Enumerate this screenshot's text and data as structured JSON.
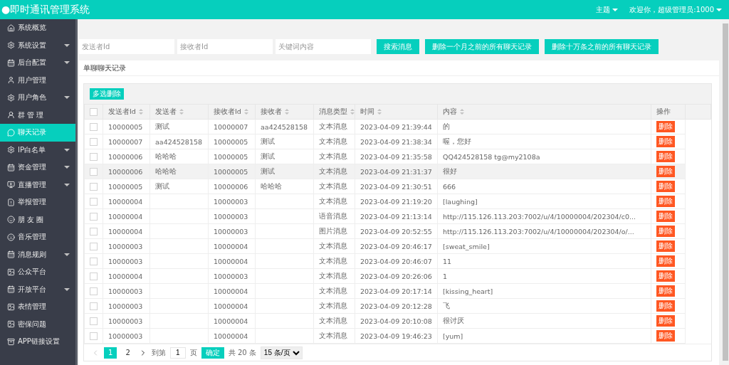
{
  "header": {
    "title": "●即时通讯管理系统",
    "theme_menu": "主题",
    "user_menu": "欢迎你，超级管理员:1000"
  },
  "sidebar": {
    "items": [
      {
        "label": "系统概览",
        "selected": false,
        "expandable": false
      },
      {
        "label": "系统设置",
        "selected": false,
        "expandable": true
      },
      {
        "label": "后台配置",
        "selected": false,
        "expandable": true
      },
      {
        "label": "用户管理",
        "selected": false,
        "expandable": false
      },
      {
        "label": "用户角色",
        "selected": false,
        "expandable": true
      },
      {
        "label": "群 管 理",
        "selected": false,
        "expandable": false
      },
      {
        "label": "聊天记录",
        "selected": true,
        "expandable": false
      },
      {
        "label": "IP白名单",
        "selected": false,
        "expandable": true
      },
      {
        "label": "资金管理",
        "selected": false,
        "expandable": true
      },
      {
        "label": "直播管理",
        "selected": false,
        "expandable": true
      },
      {
        "label": "举报管理",
        "selected": false,
        "expandable": false
      },
      {
        "label": "朋 友 圈",
        "selected": false,
        "expandable": false
      },
      {
        "label": "音乐管理",
        "selected": false,
        "expandable": false
      },
      {
        "label": "消息规则",
        "selected": false,
        "expandable": true
      },
      {
        "label": "公众平台",
        "selected": false,
        "expandable": false
      },
      {
        "label": "开放平台",
        "selected": false,
        "expandable": true
      },
      {
        "label": "表情管理",
        "selected": false,
        "expandable": false
      },
      {
        "label": "密保问题",
        "selected": false,
        "expandable": false
      },
      {
        "label": "APP链接设置",
        "selected": false,
        "expandable": false
      }
    ]
  },
  "filters": {
    "fields": [
      {
        "placeholder": "发送者Id"
      },
      {
        "placeholder": "接收者Id"
      },
      {
        "placeholder": "关键词内容"
      }
    ],
    "buttons": [
      "搜索消息",
      "删除一个月之前的所有聊天记录",
      "删除十万条之前的所有聊天记录"
    ]
  },
  "panel": {
    "title": "单聊聊天记录",
    "batch_delete": "多选删除",
    "table": {
      "select_all_checked": false,
      "columns": [
        "发送者Id",
        "发送者",
        "接收者Id",
        "接收者",
        "消息类型",
        "时间",
        "内容",
        "操作"
      ],
      "sortable": [
        true,
        true,
        true,
        true,
        true,
        true,
        true,
        false
      ],
      "rows": [
        {
          "cells": [
            "10000005",
            "测试",
            "10000007",
            "aa424528158",
            "文本消息",
            "2023-04-09 21:39:44",
            "的"
          ],
          "action": "删除",
          "checked": false,
          "hovered": false
        },
        {
          "cells": [
            "10000007",
            "aa424528158",
            "10000005",
            "测试",
            "文本消息",
            "2023-04-09 21:38:34",
            "喔，您好"
          ],
          "action": "删除",
          "checked": false,
          "hovered": false
        },
        {
          "cells": [
            "10000006",
            "哈哈哈",
            "10000005",
            "测试",
            "文本消息",
            "2023-04-09 21:35:58",
            "QQ424528158 tg@my2108a"
          ],
          "action": "删除",
          "checked": false,
          "hovered": false
        },
        {
          "cells": [
            "10000006",
            "哈哈哈",
            "10000005",
            "测试",
            "文本消息",
            "2023-04-09 21:31:37",
            "很好"
          ],
          "action": "删除",
          "checked": false,
          "hovered": true
        },
        {
          "cells": [
            "10000005",
            "测试",
            "10000006",
            "哈哈哈",
            "文本消息",
            "2023-04-09 21:30:51",
            "666"
          ],
          "action": "删除",
          "checked": false,
          "hovered": false
        },
        {
          "cells": [
            "10000004",
            "",
            "10000003",
            "",
            "文本消息",
            "2023-04-09 21:19:20",
            "[laughing]"
          ],
          "action": "删除",
          "checked": false,
          "hovered": false
        },
        {
          "cells": [
            "10000004",
            "",
            "10000003",
            "",
            "语音消息",
            "2023-04-09 21:13:14",
            "http://115.126.113.203:7002/u/4/10000004/202304/c0..."
          ],
          "action": "删除",
          "checked": false,
          "hovered": false
        },
        {
          "cells": [
            "10000004",
            "",
            "10000003",
            "",
            "图片消息",
            "2023-04-09 20:52:55",
            "http://115.126.113.203:7002/u/4/10000004/202304/o/..."
          ],
          "action": "删除",
          "checked": false,
          "hovered": false
        },
        {
          "cells": [
            "10000003",
            "",
            "10000004",
            "",
            "文本消息",
            "2023-04-09 20:46:17",
            "[sweat_smile]"
          ],
          "action": "删除",
          "checked": false,
          "hovered": false
        },
        {
          "cells": [
            "10000003",
            "",
            "10000004",
            "",
            "文本消息",
            "2023-04-09 20:46:07",
            "11"
          ],
          "action": "删除",
          "checked": false,
          "hovered": false
        },
        {
          "cells": [
            "10000004",
            "",
            "10000003",
            "",
            "文本消息",
            "2023-04-09 20:26:06",
            "1"
          ],
          "action": "删除",
          "checked": false,
          "hovered": false
        },
        {
          "cells": [
            "10000003",
            "",
            "10000004",
            "",
            "文本消息",
            "2023-04-09 20:17:14",
            "[kissing_heart]"
          ],
          "action": "删除",
          "checked": false,
          "hovered": false
        },
        {
          "cells": [
            "10000003",
            "",
            "10000004",
            "",
            "文本消息",
            "2023-04-09 20:12:28",
            "飞"
          ],
          "action": "删除",
          "checked": false,
          "hovered": false
        },
        {
          "cells": [
            "10000003",
            "",
            "10000004",
            "",
            "文本消息",
            "2023-04-09 20:10:08",
            "很讨厌"
          ],
          "action": "删除",
          "checked": false,
          "hovered": false
        },
        {
          "cells": [
            "10000003",
            "",
            "10000004",
            "",
            "文本消息",
            "2023-04-09 19:46:23",
            "[yum]"
          ],
          "action": "删除",
          "checked": false,
          "hovered": false
        }
      ]
    },
    "pagination": {
      "pages": [
        {
          "label": "1",
          "selected": true
        },
        {
          "label": "2",
          "selected": false
        }
      ],
      "goto_label": "到第",
      "goto_value": "1",
      "page_unit": "页",
      "confirm": "确定",
      "total": "共 20 条",
      "page_size": "15 条/页"
    }
  }
}
